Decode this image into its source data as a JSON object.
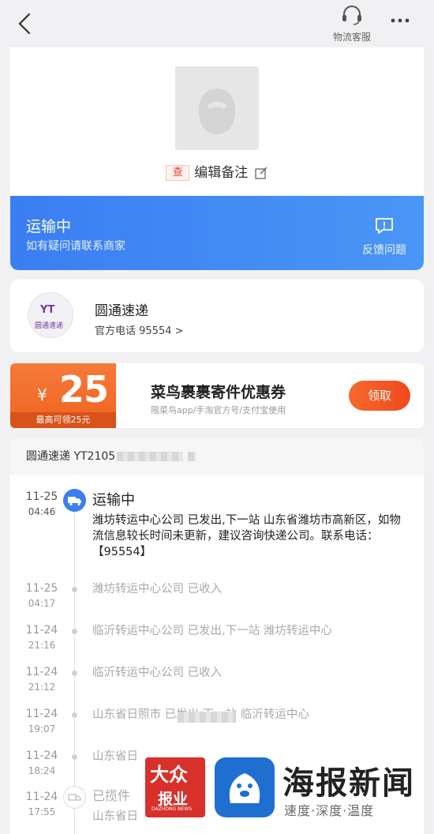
{
  "topbar": {
    "service_label": "物流客服"
  },
  "package": {
    "tag": "查",
    "note_label": "编辑备注"
  },
  "status": {
    "title": "运输中",
    "subtitle": "如有疑问请联系商家",
    "feedback_label": "反馈问题"
  },
  "courier": {
    "logo_text": "YT",
    "logo_name": "圆通速递",
    "name": "圆通速递",
    "phone": "官方电话 95554 >"
  },
  "coupon": {
    "currency": "¥",
    "amount": "25",
    "max_label": "最高可领25元",
    "title": "菜鸟裹裹寄件优惠券",
    "subtitle": "限菜鸟app/手淘官方号/支付宝使用",
    "claim_label": "领取"
  },
  "tracking": {
    "header_prefix": "圆通速递 YT2105",
    "current": {
      "date": "11-25",
      "time": "04:46",
      "title": "运输中",
      "text": "潍坊转运中心公司 已发出,下一站 山东省潍坊市高新区，如物流信息较长时间未更新，建议咨询快递公司。联系电话：【95554】"
    },
    "events": [
      {
        "date": "11-25",
        "time": "04:17",
        "text": "潍坊转运中心公司 已收入"
      },
      {
        "date": "11-24",
        "time": "21:16",
        "text": "临沂转运中心公司 已发出,下一站 潍坊转运中心"
      },
      {
        "date": "11-24",
        "time": "21:12",
        "text": "临沂转运中心公司 已收入"
      },
      {
        "date": "11-24",
        "time": "19:07",
        "text": "山东省日照市            已发出,下一站 临沂转运中心"
      },
      {
        "date": "11-24",
        "time": "18:24",
        "text": "山东省日"
      }
    ],
    "pickup": {
      "date": "11-24",
      "time": "17:55",
      "title": "已揽件",
      "text": "山东省日"
    }
  },
  "watermark": {
    "brand_top": "大众",
    "brand_bottom": "报业",
    "brand_en": "DAZHONG NEWS",
    "title": "海报新闻",
    "slogan": "速度·深度·温度"
  }
}
